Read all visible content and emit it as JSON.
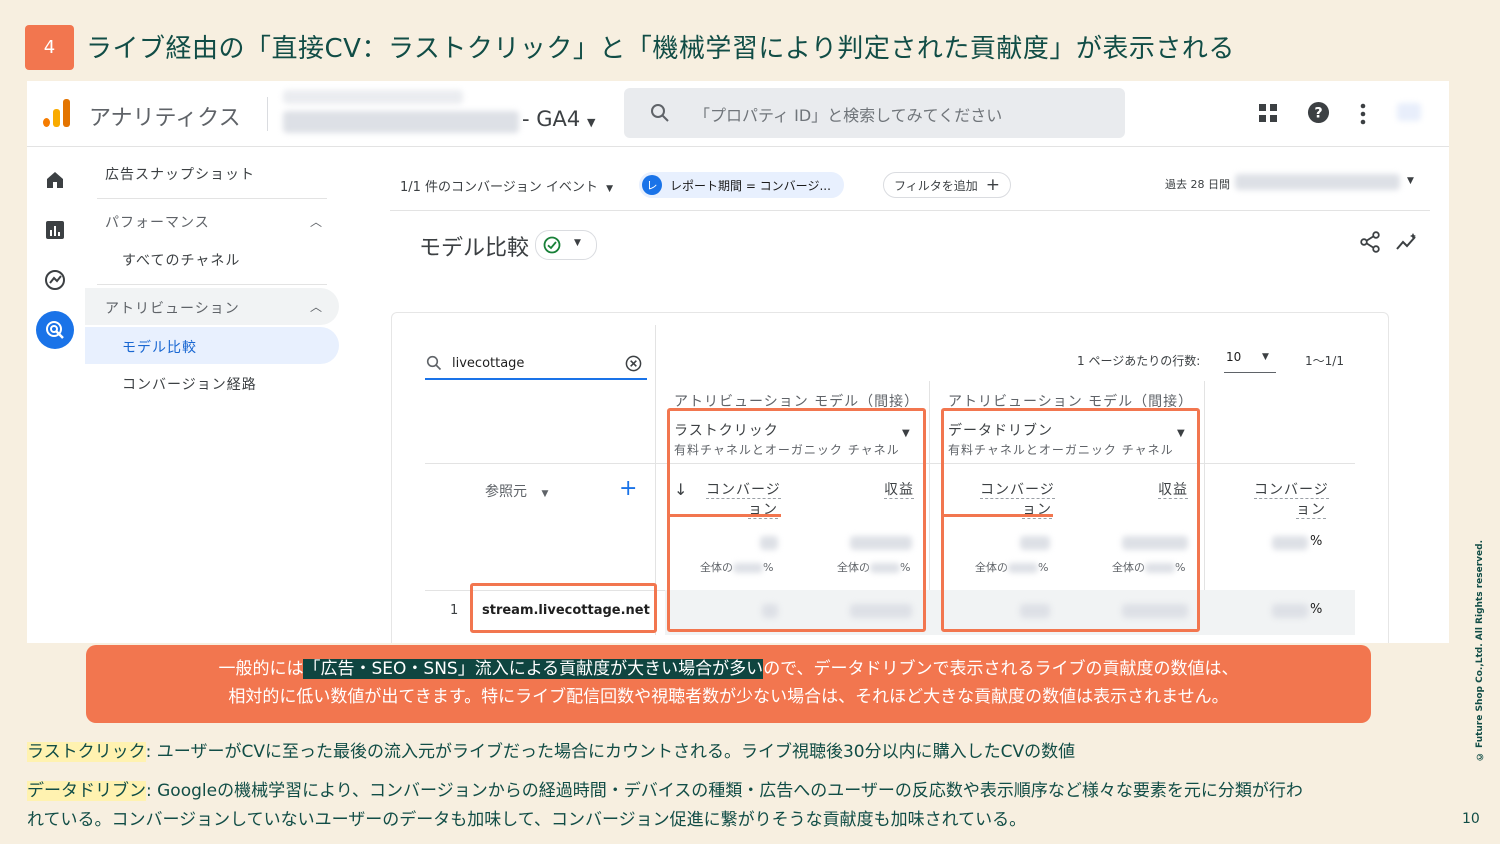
{
  "slide": {
    "number": "4",
    "title": "ライブ経由の「直接CV：ラストクリック」と「機械学習により判定された貢献度」が表示される",
    "page": "10",
    "copyright": "© Future Shop Co.,Ltd. All Rights reserved."
  },
  "app": {
    "name": "アナリティクス",
    "property_suffix": "- GA4",
    "search_placeholder": "「プロパティ ID」と検索してみてください",
    "icons": [
      "grid-icon",
      "help-icon",
      "more-icon"
    ]
  },
  "sidebar": {
    "items": [
      {
        "label": "広告スナップショット"
      },
      {
        "label": "パフォーマンス"
      },
      {
        "label": "すべてのチャネル"
      },
      {
        "label": "アトリビューション"
      },
      {
        "label": "モデル比較"
      },
      {
        "label": "コンバージョン経路"
      }
    ]
  },
  "filters": {
    "conversion_event": "1/1 件のコンバージョン イベント",
    "report_period": "レポート期間 = コンバージ...",
    "report_badge": "レ",
    "add_filter": "フィルタを追加",
    "date_range_label": "過去 28 日間"
  },
  "report": {
    "title": "モデル比較"
  },
  "table": {
    "search_value": "livecottage",
    "rows_per_page_label": "1 ページあたりの行数:",
    "rows_per_page": "10",
    "range": "1〜1/1",
    "dimension_header": "参照元",
    "model_header": "アトリビューション モデル（間接）",
    "models": [
      {
        "name": "ラストクリック",
        "scope": "有料チャネルとオーガニック チャネル"
      },
      {
        "name": "データドリブン",
        "scope": "有料チャネルとオーガニック チャネル"
      }
    ],
    "conv_label_1": "コンバージ",
    "conv_label_2": "ョン",
    "revenue_label": "収益",
    "total_prefix": "全体の",
    "percent": "%",
    "row": {
      "index": "1",
      "source": "stream.livecottage.net"
    }
  },
  "banner": {
    "line1_pre": "一般的には",
    "line1_highlight": "「広告・SEO・SNS」流入による貢献度が大きい場合が多い",
    "line1_post": "ので、データドリブンで表示されるライブの貢献度の数値は、",
    "line2": "相対的に低い数値が出てきます。特にライブ配信回数や視聴者数が少ない場合は、それほど大きな貢献度の数値は表示されません。"
  },
  "notes": {
    "lastclick_term": "ラストクリック",
    "lastclick_desc": ": ユーザーがCVに至った最後の流入元がライブだった場合にカウントされる。ライブ視聴後30分以内に購入したCVの数値",
    "datadriven_term": "データドリブン",
    "datadriven_desc1": ": Googleの機械学習により、コンバージョンからの経過時間・デバイスの種類・広告へのユーザーの反応数や表示順序など様々な要素を元に分類が行わ",
    "datadriven_desc2": "れている。コンバージョンしていないユーザーのデータも加味して、コンバージョン促進に繋がりそうな貢献度も加味されている。"
  },
  "colors": {
    "accent": "#f2764f",
    "title": "#114d46",
    "background": "#f7efe0",
    "ga_blue": "#1a73e8",
    "highlight_dark": "#0f4540",
    "highlight_yellow": "#fff2b0"
  }
}
